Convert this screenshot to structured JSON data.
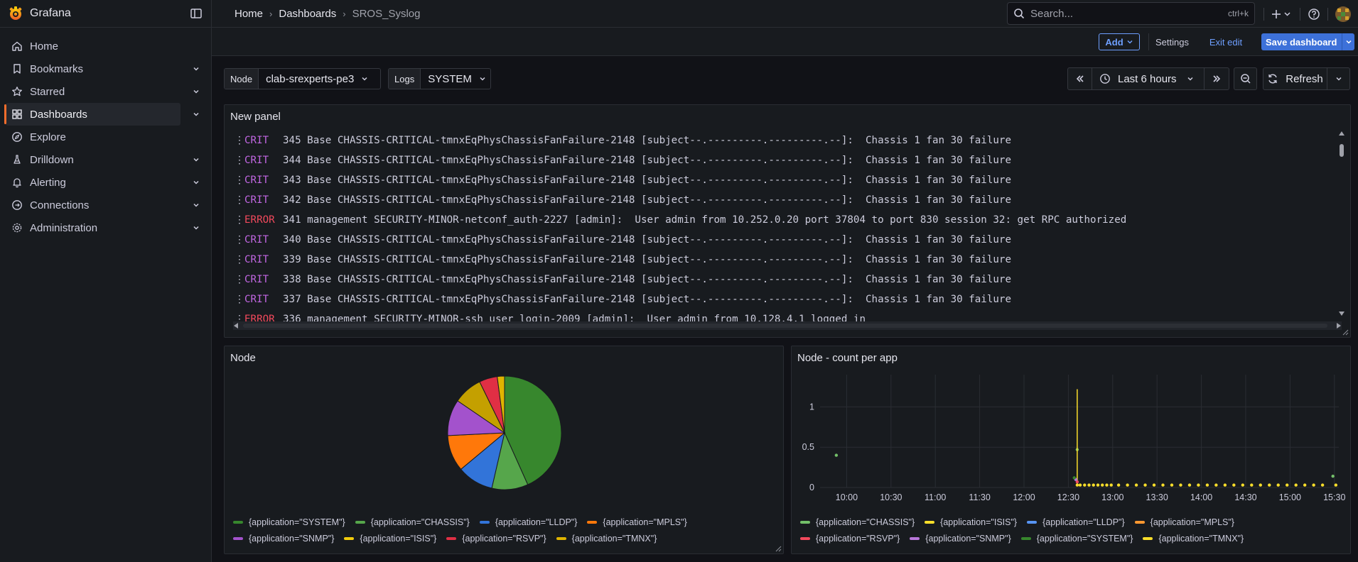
{
  "app": {
    "name": "Grafana"
  },
  "breadcrumb": [
    "Home",
    "Dashboards",
    "SROS_Syslog"
  ],
  "search": {
    "placeholder": "Search...",
    "shortcut": "ctrl+k"
  },
  "sidebar": {
    "items": [
      {
        "label": "Home",
        "icon": "home-icon",
        "chevron": false,
        "active": false
      },
      {
        "label": "Bookmarks",
        "icon": "bookmark-icon",
        "chevron": true,
        "active": false
      },
      {
        "label": "Starred",
        "icon": "star-icon",
        "chevron": true,
        "active": false
      },
      {
        "label": "Dashboards",
        "icon": "apps-icon",
        "chevron": true,
        "active": true
      },
      {
        "label": "Explore",
        "icon": "compass-icon",
        "chevron": false,
        "active": false
      },
      {
        "label": "Drilldown",
        "icon": "drilldown-icon",
        "chevron": true,
        "active": false
      },
      {
        "label": "Alerting",
        "icon": "bell-icon",
        "chevron": true,
        "active": false
      },
      {
        "label": "Connections",
        "icon": "link-icon",
        "chevron": true,
        "active": false
      },
      {
        "label": "Administration",
        "icon": "cog-icon",
        "chevron": true,
        "active": false
      }
    ]
  },
  "toolbar": {
    "add_label": "Add",
    "settings_label": "Settings",
    "exit_edit_label": "Exit edit",
    "save_label": "Save dashboard"
  },
  "variables": [
    {
      "name": "Node",
      "value": "clab-srexperts-pe3"
    },
    {
      "name": "Logs",
      "value": "SYSTEM"
    }
  ],
  "time": {
    "range": "Last 6 hours",
    "refresh_label": "Refresh"
  },
  "logs_panel": {
    "title": "New panel",
    "lines": [
      {
        "level": "CRIT",
        "text": "345 Base CHASSIS-CRITICAL-tmnxEqPhysChassisFanFailure-2148 [subject--.---------.---------.--]:  Chassis 1 fan 30 failure"
      },
      {
        "level": "CRIT",
        "text": "344 Base CHASSIS-CRITICAL-tmnxEqPhysChassisFanFailure-2148 [subject--.---------.---------.--]:  Chassis 1 fan 30 failure"
      },
      {
        "level": "CRIT",
        "text": "343 Base CHASSIS-CRITICAL-tmnxEqPhysChassisFanFailure-2148 [subject--.---------.---------.--]:  Chassis 1 fan 30 failure"
      },
      {
        "level": "CRIT",
        "text": "342 Base CHASSIS-CRITICAL-tmnxEqPhysChassisFanFailure-2148 [subject--.---------.---------.--]:  Chassis 1 fan 30 failure"
      },
      {
        "level": "ERROR",
        "text": "341 management SECURITY-MINOR-netconf_auth-2227 [admin]:  User admin from 10.252.0.20 port 37804 to port 830 session 32: get RPC authorized"
      },
      {
        "level": "CRIT",
        "text": "340 Base CHASSIS-CRITICAL-tmnxEqPhysChassisFanFailure-2148 [subject--.---------.---------.--]:  Chassis 1 fan 30 failure"
      },
      {
        "level": "CRIT",
        "text": "339 Base CHASSIS-CRITICAL-tmnxEqPhysChassisFanFailure-2148 [subject--.---------.---------.--]:  Chassis 1 fan 30 failure"
      },
      {
        "level": "CRIT",
        "text": "338 Base CHASSIS-CRITICAL-tmnxEqPhysChassisFanFailure-2148 [subject--.---------.---------.--]:  Chassis 1 fan 30 failure"
      },
      {
        "level": "CRIT",
        "text": "337 Base CHASSIS-CRITICAL-tmnxEqPhysChassisFanFailure-2148 [subject--.---------.---------.--]:  Chassis 1 fan 30 failure"
      },
      {
        "level": "ERROR",
        "text": "336 management SECURITY-MINOR-ssh_user_login-2009 [admin]:  User admin from 10.128.4.1 logged in"
      }
    ]
  },
  "pie_panel": {
    "title": "Node",
    "legend": [
      {
        "label": "{application=\"SYSTEM\"}",
        "color": "#37872d"
      },
      {
        "label": "{application=\"CHASSIS\"}",
        "color": "#56a64b"
      },
      {
        "label": "{application=\"LLDP\"}",
        "color": "#3274d9"
      },
      {
        "label": "{application=\"MPLS\"}",
        "color": "#ff780a"
      },
      {
        "label": "{application=\"SNMP\"}",
        "color": "#a352cc"
      },
      {
        "label": "{application=\"ISIS\"}",
        "color": "#f2cc0c"
      },
      {
        "label": "{application=\"RSVP\"}",
        "color": "#e02f44"
      },
      {
        "label": "{application=\"TMNX\"}",
        "color": "#e0b400"
      }
    ]
  },
  "ts_panel": {
    "title": "Node - count per app",
    "legend": [
      {
        "label": "{application=\"CHASSIS\"}",
        "color": "#73bf69"
      },
      {
        "label": "{application=\"ISIS\"}",
        "color": "#fade2a"
      },
      {
        "label": "{application=\"LLDP\"}",
        "color": "#5794f2"
      },
      {
        "label": "{application=\"MPLS\"}",
        "color": "#ff9830"
      },
      {
        "label": "{application=\"RSVP\"}",
        "color": "#f2495c"
      },
      {
        "label": "{application=\"SNMP\"}",
        "color": "#b877d9"
      },
      {
        "label": "{application=\"SYSTEM\"}",
        "color": "#37872d"
      },
      {
        "label": "{application=\"TMNX\"}",
        "color": "#fade2a"
      }
    ]
  },
  "chart_data": [
    {
      "type": "pie",
      "title": "Node",
      "categories": [
        "SYSTEM",
        "CHASSIS",
        "LLDP",
        "MPLS",
        "SNMP",
        "ISIS",
        "RSVP",
        "TMNX"
      ],
      "values": [
        42,
        10,
        10,
        10,
        10,
        8,
        5,
        2
      ],
      "colors": [
        "#37872d",
        "#56a64b",
        "#3274d9",
        "#ff780a",
        "#a352cc",
        "#c4a000",
        "#e02f44",
        "#e0b400"
      ]
    },
    {
      "type": "scatter",
      "title": "Node - count per app",
      "x_ticks": [
        "10:00",
        "10:30",
        "11:00",
        "11:30",
        "12:00",
        "12:30",
        "13:00",
        "13:30",
        "14:00",
        "14:30",
        "15:00",
        "15:30"
      ],
      "y_ticks": [
        "0",
        "0.5",
        "1"
      ],
      "ylim": [
        0,
        1.4
      ],
      "xlim": [
        "09:42",
        "15:33"
      ],
      "series": [
        {
          "name": "{application=\"CHASSIS\"}",
          "points": [
            [
              "09:53",
              0.4
            ],
            [
              "15:29",
              0.14
            ],
            [
              "12:36",
              0.47
            ]
          ]
        },
        {
          "name": "{application=\"ISIS\"}",
          "spike": [
            "12:36",
            1.22
          ],
          "points": [
            [
              "12:36",
              0.03
            ],
            [
              "12:38",
              0.03
            ],
            [
              "12:41",
              0.03
            ],
            [
              "12:44",
              0.03
            ],
            [
              "12:47",
              0.03
            ],
            [
              "12:50",
              0.03
            ],
            [
              "12:53",
              0.03
            ],
            [
              "12:56",
              0.03
            ],
            [
              "12:59",
              0.03
            ],
            [
              "13:04",
              0.03
            ],
            [
              "13:10",
              0.03
            ],
            [
              "13:16",
              0.03
            ],
            [
              "13:22",
              0.03
            ],
            [
              "13:28",
              0.03
            ],
            [
              "13:34",
              0.03
            ],
            [
              "13:40",
              0.03
            ],
            [
              "13:46",
              0.03
            ],
            [
              "13:52",
              0.03
            ],
            [
              "13:58",
              0.03
            ],
            [
              "14:04",
              0.03
            ],
            [
              "14:10",
              0.03
            ],
            [
              "14:16",
              0.03
            ],
            [
              "14:22",
              0.03
            ],
            [
              "14:28",
              0.03
            ],
            [
              "14:34",
              0.03
            ],
            [
              "14:40",
              0.03
            ],
            [
              "14:46",
              0.03
            ],
            [
              "14:52",
              0.03
            ],
            [
              "14:58",
              0.03
            ],
            [
              "15:04",
              0.03
            ],
            [
              "15:10",
              0.03
            ],
            [
              "15:16",
              0.03
            ],
            [
              "15:22",
              0.03
            ],
            [
              "15:31",
              0.03
            ]
          ]
        },
        {
          "name": "{application=\"RSVP\"}",
          "points": [
            [
              "12:36",
              0.07
            ]
          ]
        },
        {
          "name": "{application=\"SNMP\"}",
          "points": [
            [
              "12:35",
              0.1
            ]
          ]
        },
        {
          "name": "{application=\"SYSTEM\"}",
          "points": [
            [
              "12:34",
              0.12
            ]
          ]
        }
      ]
    }
  ]
}
